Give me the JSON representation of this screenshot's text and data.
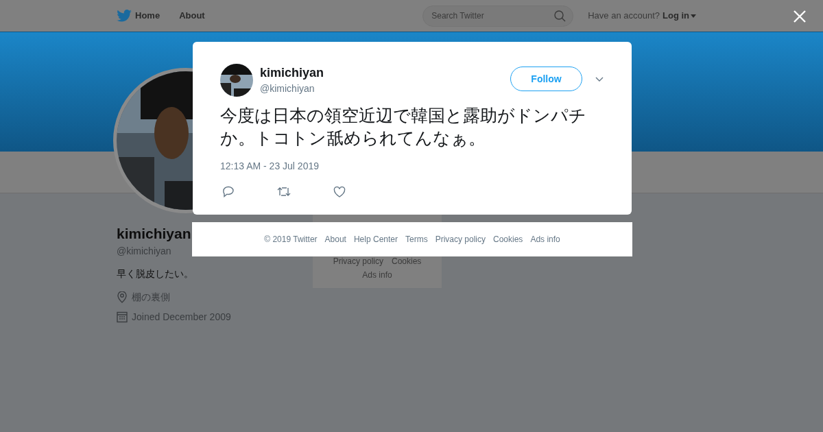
{
  "header": {
    "nav": [
      "Home",
      "About"
    ],
    "search": {
      "placeholder": "Search Twitter"
    },
    "account_prompt": "Have an account?",
    "login": "Log in"
  },
  "profile": {
    "name": "kimichiyan",
    "handle": "@kimichiyan",
    "bio": "早く脱皮したい。",
    "location": "棚の裏側",
    "joined": "Joined December 2009"
  },
  "sidebar_footer": [
    "Privacy policy",
    "Cookies",
    "Ads info"
  ],
  "tweet": {
    "name": "kimichiyan",
    "handle": "@kimichiyan",
    "follow": "Follow",
    "text": "今度は日本の領空近辺で韓国と露助がドンパチか。トコトン舐められてんなぁ。",
    "timestamp": "12:13 AM - 23 Jul 2019"
  },
  "footer": [
    "© 2019 Twitter",
    "About",
    "Help Center",
    "Terms",
    "Privacy policy",
    "Cookies",
    "Ads info"
  ]
}
